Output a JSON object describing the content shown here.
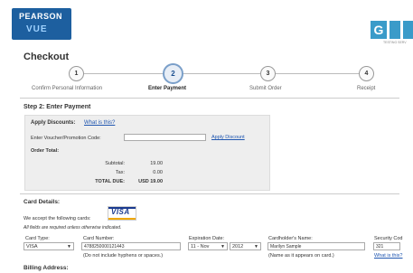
{
  "header": {
    "pearson_text": "PEARSON",
    "vue_text": "VUE",
    "right_logo_letter": "G",
    "right_logo_sub": "TESTING SERV"
  },
  "page_title": "Checkout",
  "steps": [
    {
      "num": "1",
      "label": "Confirm Personal Information"
    },
    {
      "num": "2",
      "label": "Enter Payment"
    },
    {
      "num": "3",
      "label": "Submit Order"
    },
    {
      "num": "4",
      "label": "Receipt"
    }
  ],
  "step2_heading": "Step 2: Enter Payment",
  "discounts": {
    "heading": "Apply Discounts:",
    "what_link": "What is this?",
    "voucher_label": "Enter Voucher/Promotion Code:",
    "voucher_value": "",
    "apply_link": "Apply Discount",
    "order_total_label": "Order Total:",
    "subtotal_label": "Subtotal:",
    "subtotal_value": "19.00",
    "tax_label": "Tax:",
    "tax_value": "0.00",
    "total_label": "TOTAL DUE:",
    "total_value": "USD 19.00"
  },
  "card": {
    "heading": "Card Details:",
    "accept_text": "We accept the following cards:",
    "visa_text": "VISA",
    "required_note": "All fields are required unless otherwise indicated.",
    "type_label": "Card Type:",
    "type_value": "VISA",
    "number_label": "Card Number:",
    "number_value": "4788250000121443",
    "number_hint": "(Do not include hyphens or spaces.)",
    "exp_label": "Expiration Date:",
    "exp_month": "11 - Nov",
    "exp_year": "2012",
    "holder_label": "Cardholder's Name:",
    "holder_value": "Marilyn Sample",
    "holder_hint": "(Name as it appears on card.)",
    "security_label": "Security Cod",
    "security_value": "321",
    "security_link": "What is this?"
  },
  "billing_heading": "Billing Address:"
}
